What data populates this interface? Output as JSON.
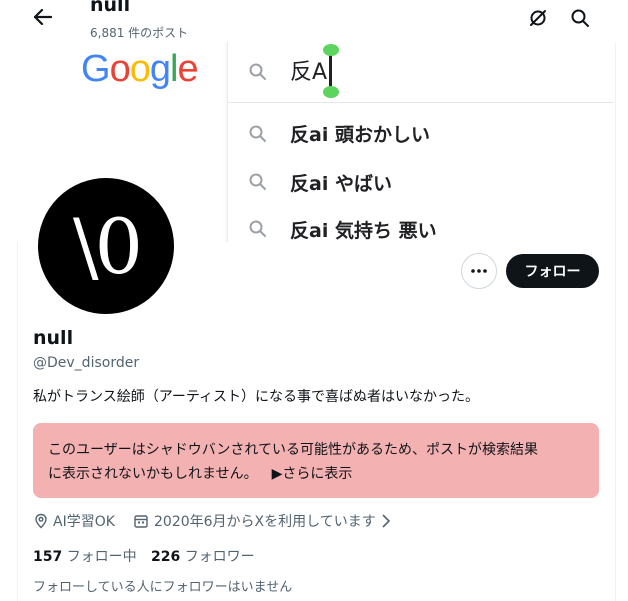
{
  "header": {
    "title": "null",
    "post_count": "6,881 件のポスト"
  },
  "banner": {
    "logo_letters": [
      {
        "char": "G",
        "color": "#4285f4"
      },
      {
        "char": "o",
        "color": "#ea4335"
      },
      {
        "char": "o",
        "color": "#fbbc05"
      },
      {
        "char": "g",
        "color": "#4285f4"
      },
      {
        "char": "l",
        "color": "#34a853"
      },
      {
        "char": "e",
        "color": "#ea4335"
      }
    ],
    "query": "反AI",
    "suggestions": [
      "反ai 頭おかしい",
      "反ai やばい",
      "反ai 気持ち 悪い"
    ]
  },
  "avatar": {
    "text": "\\0"
  },
  "profile": {
    "follow_label": "フォロー",
    "name": "null",
    "handle": "@Dev_disorder",
    "bio": "私がトランス絵師（アーティスト）になる事で喜ばぬ者はいなかった。",
    "warning_line1": "このユーザーはシャドウバンされている可能性があるため、ポストが検索結果",
    "warning_line2": "に表示されないかもしれません。",
    "warning_more": "▶さらに表示",
    "location": "AI学習OK",
    "joined": "2020年6月からXを利用しています",
    "following_count": "157",
    "following_label": "フォロー中",
    "followers_count": "226",
    "followers_label": "フォロワー",
    "followers_note": "フォローしている人にフォロワーはいません"
  },
  "colors": {
    "warning_bg": "#f4b1b2",
    "follow_bg": "#0f1419",
    "handle_green": "#5dd45d"
  }
}
